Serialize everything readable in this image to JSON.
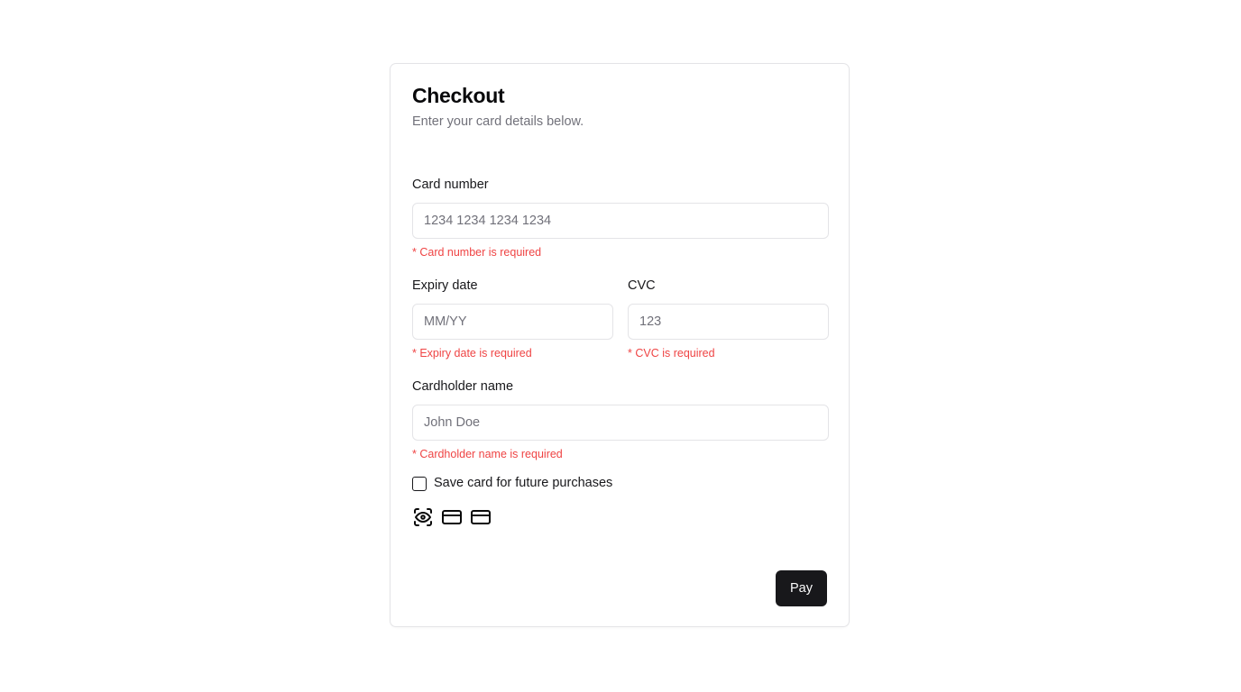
{
  "header": {
    "title": "Checkout",
    "subtitle": "Enter your card details below."
  },
  "fields": {
    "card_number": {
      "label": "Card number",
      "value": "",
      "placeholder": "1234 1234 1234 1234",
      "error": "* Card number is required"
    },
    "expiry": {
      "label": "Expiry date",
      "value": "",
      "placeholder": "MM/YY",
      "error": "* Expiry date is required"
    },
    "cvc": {
      "label": "CVC",
      "value": "",
      "placeholder": "123",
      "error": "* CVC is required"
    },
    "cardholder": {
      "label": "Cardholder name",
      "value": "",
      "placeholder": "John Doe",
      "error": "* Cardholder name is required"
    }
  },
  "save_card": {
    "label": "Save card for future purchases",
    "checked": false
  },
  "payment_icons": [
    "eye-icon",
    "credit-card-icon",
    "credit-card-icon"
  ],
  "actions": {
    "pay_label": "Pay"
  },
  "colors": {
    "primary": "#18181b",
    "error": "#ef4444",
    "muted_text": "#71717a",
    "border": "#e4e4e7"
  }
}
